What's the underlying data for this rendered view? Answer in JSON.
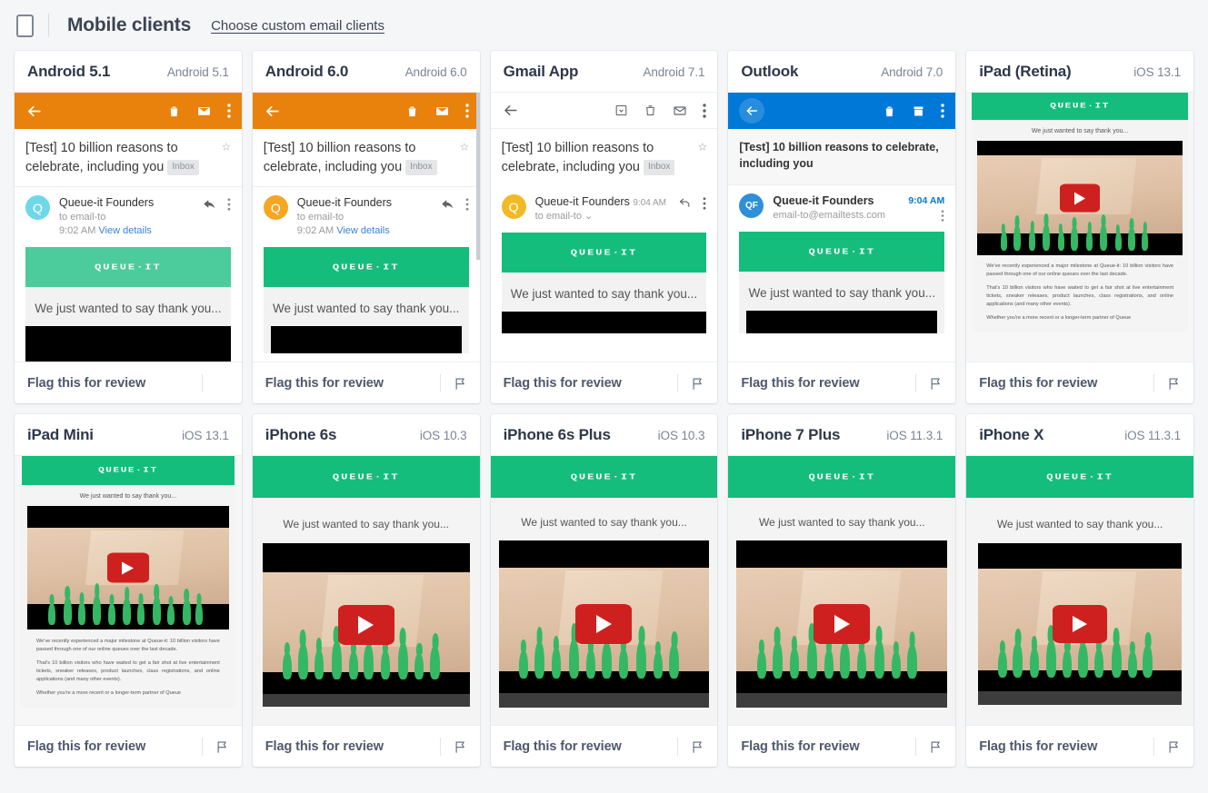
{
  "header": {
    "device_icon": "mobile-device-icon",
    "title": "Mobile clients",
    "link": "Choose custom email clients"
  },
  "footer_common": {
    "flag_label": "Flag this for review",
    "flag_icon": "flag-icon"
  },
  "email": {
    "subject": "[Test] 10 billion reasons to celebrate, including you",
    "subject_outlook": "[Test] 10 billion reasons to celebrate, including you",
    "chip": "Inbox",
    "sender": "Queue-it Founders",
    "to_short": "to email-to",
    "to_address": "email-to@emailtests.com",
    "view_details": "View details",
    "time_902": "9:02 AM",
    "time_904": "9:04 AM",
    "logo": "QUEUE·IT",
    "thank_you": "We just wanted to say thank you...",
    "body_p1": "We've recently experienced a major milestone at Queue-it: 10 billion visitors have passed through one of our online queues over the last decade.",
    "body_p2": "That's 10 billion visitors who have waited to get a fair shot at live entertainment tickets, sneaker releases, product launches, class registrations, and online applications (and many other events).",
    "body_p3": "Whether you're a more recent or a longer-term partner of Queue"
  },
  "colors": {
    "android_toolbar": "#e8820c",
    "outlook_toolbar": "#0078d7",
    "gmail_toolbar": "#ffffff",
    "banner_light_green": "#4ccb9c",
    "banner_green": "#15bd7c",
    "avatar_cyan": "#6fd8e8",
    "avatar_orange": "#f5a623",
    "avatar_yellow": "#f0ba26",
    "avatar_blue": "#2f8fd8",
    "play_red": "#cf2020"
  },
  "cards": [
    {
      "title": "Android 5.1",
      "version": "Android 5.1"
    },
    {
      "title": "Android 6.0",
      "version": "Android 6.0"
    },
    {
      "title": "Gmail App",
      "version": "Android 7.1"
    },
    {
      "title": "Outlook",
      "version": "Android 7.0"
    },
    {
      "title": "iPad (Retina)",
      "version": "iOS 13.1"
    },
    {
      "title": "iPad Mini",
      "version": "iOS 13.1"
    },
    {
      "title": "iPhone 6s",
      "version": "iOS 10.3"
    },
    {
      "title": "iPhone 6s Plus",
      "version": "iOS 10.3"
    },
    {
      "title": "iPhone 7 Plus",
      "version": "iOS 11.3.1"
    },
    {
      "title": "iPhone X",
      "version": "iOS 11.3.1"
    }
  ]
}
